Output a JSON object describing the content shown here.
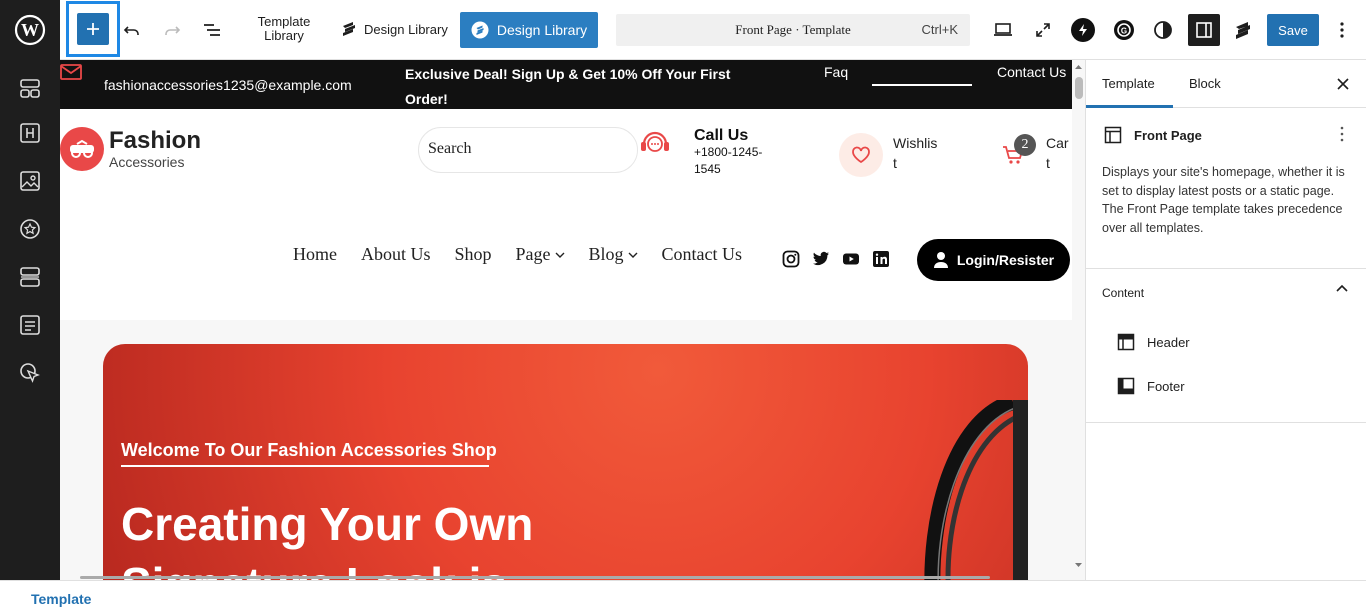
{
  "toolbar": {
    "template_library_label": "Template Library",
    "design_library_label": "Design Library",
    "design_library_button_label": "Design Library",
    "command_bar_title": "Front Page · Template",
    "command_bar_shortcut": "Ctrl+K",
    "save_label": "Save"
  },
  "left_sidebar": {
    "icons": [
      "layout-grid-icon",
      "heading-icon",
      "image-icon",
      "star-badge-icon",
      "rows-icon",
      "form-icon",
      "pointer-click-icon"
    ]
  },
  "canvas": {
    "topstrip": {
      "email": "fashionaccessories1235@example.com",
      "deal": "Exclusive Deal! Sign Up & Get 10% Off Your First Order!",
      "faq": "Faq",
      "contact": "Contact Us"
    },
    "header": {
      "logo_name": "Fashion",
      "logo_sub": "Accessories",
      "search_text": "Search",
      "call_title": "Call Us",
      "call_number": "+1800-1245-1545",
      "wishlist_label": "Wishlist",
      "cart_count": "2",
      "cart_label": "Cart"
    },
    "nav": {
      "items": [
        "Home",
        "About Us",
        "Shop",
        "Page",
        "Blog",
        "Contact Us"
      ]
    },
    "login_label": "Login/Resister",
    "hero": {
      "kicker": "Welcome To Our Fashion Accessories Shop",
      "heading": "Creating Your Own Signature Look is"
    }
  },
  "panel": {
    "tabs": [
      "Template",
      "Block"
    ],
    "template_title": "Front Page",
    "description": "Displays your site's homepage, whether it is set to display latest posts or a static page. The Front Page template takes precedence over all templates.",
    "content_title": "Content",
    "parts": [
      "Header",
      "Footer"
    ]
  },
  "footer": {
    "breadcrumb": "Template"
  },
  "colors": {
    "wp_blue": "#2271b1",
    "highlight_blue": "#1e88e5",
    "brand_red": "#e94848",
    "dark": "#1e1e1e"
  }
}
